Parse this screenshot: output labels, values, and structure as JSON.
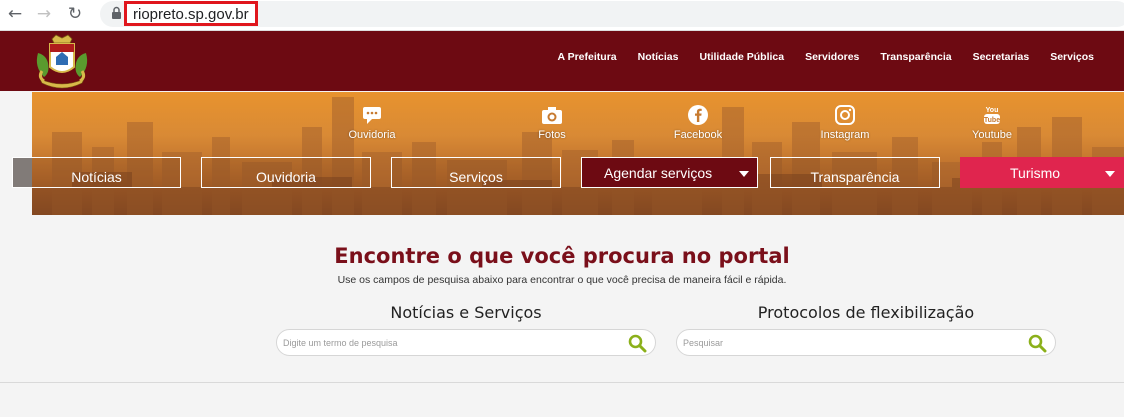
{
  "browser": {
    "url": "riopreto.sp.gov.br",
    "icons": [
      "back-arrow-icon",
      "forward-arrow-icon",
      "reload-icon",
      "lock-icon"
    ]
  },
  "header": {
    "nav": [
      {
        "label": "A Prefeitura"
      },
      {
        "label": "Notícias"
      },
      {
        "label": "Utilidade Pública"
      },
      {
        "label": "Servidores"
      },
      {
        "label": "Transparência"
      },
      {
        "label": "Secretarias"
      },
      {
        "label": "Serviços"
      }
    ],
    "colors": {
      "brand": "#6d0a12",
      "accent": "#e0254e",
      "title": "#7a0f1a",
      "search_icon": "#8bb01a"
    }
  },
  "social": [
    {
      "label": "Ouvidoria",
      "icon": "chat-icon"
    },
    {
      "label": "Fotos",
      "icon": "camera-icon"
    },
    {
      "label": "Facebook",
      "icon": "facebook-icon"
    },
    {
      "label": "Instagram",
      "icon": "instagram-icon"
    },
    {
      "label": "Youtube",
      "icon": "youtube-icon"
    }
  ],
  "quick_buttons": [
    {
      "label": "Notícias"
    },
    {
      "label": "Ouvidoria"
    },
    {
      "label": "Serviços"
    },
    {
      "label": "Agendar serviços"
    },
    {
      "label": "Transparência"
    },
    {
      "label": "Turismo"
    }
  ],
  "search": {
    "title": "Encontre o que você procura no portal",
    "subtitle": "Use os campos de pesquisa abaixo para encontrar o que você precisa de maneira fácil e rápida.",
    "columns": [
      {
        "title": "Notícias e Serviços",
        "placeholder": "Digite um termo de pesquisa"
      },
      {
        "title": "Protocolos de flexibilização",
        "placeholder": "Pesquisar"
      }
    ]
  }
}
